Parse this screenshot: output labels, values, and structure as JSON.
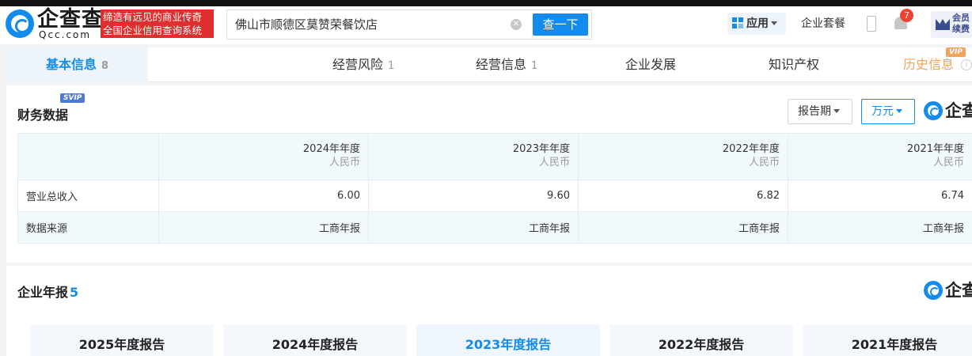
{
  "header": {
    "logo_text": "企查查",
    "logo_sub": "Qcc.com",
    "slogan_line1": "缔造有远见的商业传奇",
    "slogan_line2": "全国企业信用查询系统",
    "search_value": "佛山市顺德区莫赞荣餐饮店",
    "search_button": "查一下",
    "apps_label": "应用",
    "suite_label": "企业套餐",
    "notification_count": "7",
    "vip_line1": "会员",
    "vip_line2": "续费"
  },
  "tabs": [
    {
      "label": "基本信息",
      "count": "8"
    },
    {
      "label": "经营风险",
      "count": "1"
    },
    {
      "label": "经营信息",
      "count": "1"
    },
    {
      "label": "企业发展",
      "count": ""
    },
    {
      "label": "知识产权",
      "count": ""
    },
    {
      "label": "历史信息",
      "count": "",
      "tag": "VIP"
    }
  ],
  "financial": {
    "tag": "SVIP",
    "title": "财务数据",
    "period_select": "报告期",
    "unit_select": "万元",
    "watermark": "企查",
    "columns": [
      {
        "year": "2024年年度",
        "currency": "人民币"
      },
      {
        "year": "2023年年度",
        "currency": "人民币"
      },
      {
        "year": "2022年年度",
        "currency": "人民币"
      },
      {
        "year": "2021年年度",
        "currency": "人民币"
      }
    ],
    "rows": [
      {
        "label": "营业总收入",
        "values": [
          "6.00",
          "9.60",
          "6.82",
          "6.74"
        ]
      },
      {
        "label": "数据来源",
        "values": [
          "工商年报",
          "工商年报",
          "工商年报",
          "工商年报"
        ]
      }
    ]
  },
  "annual": {
    "title": "企业年报",
    "count": "5",
    "watermark": "企查",
    "reports": [
      "2025年度报告",
      "2024年度报告",
      "2023年度报告",
      "2022年度报告",
      "2021年度报告"
    ]
  }
}
